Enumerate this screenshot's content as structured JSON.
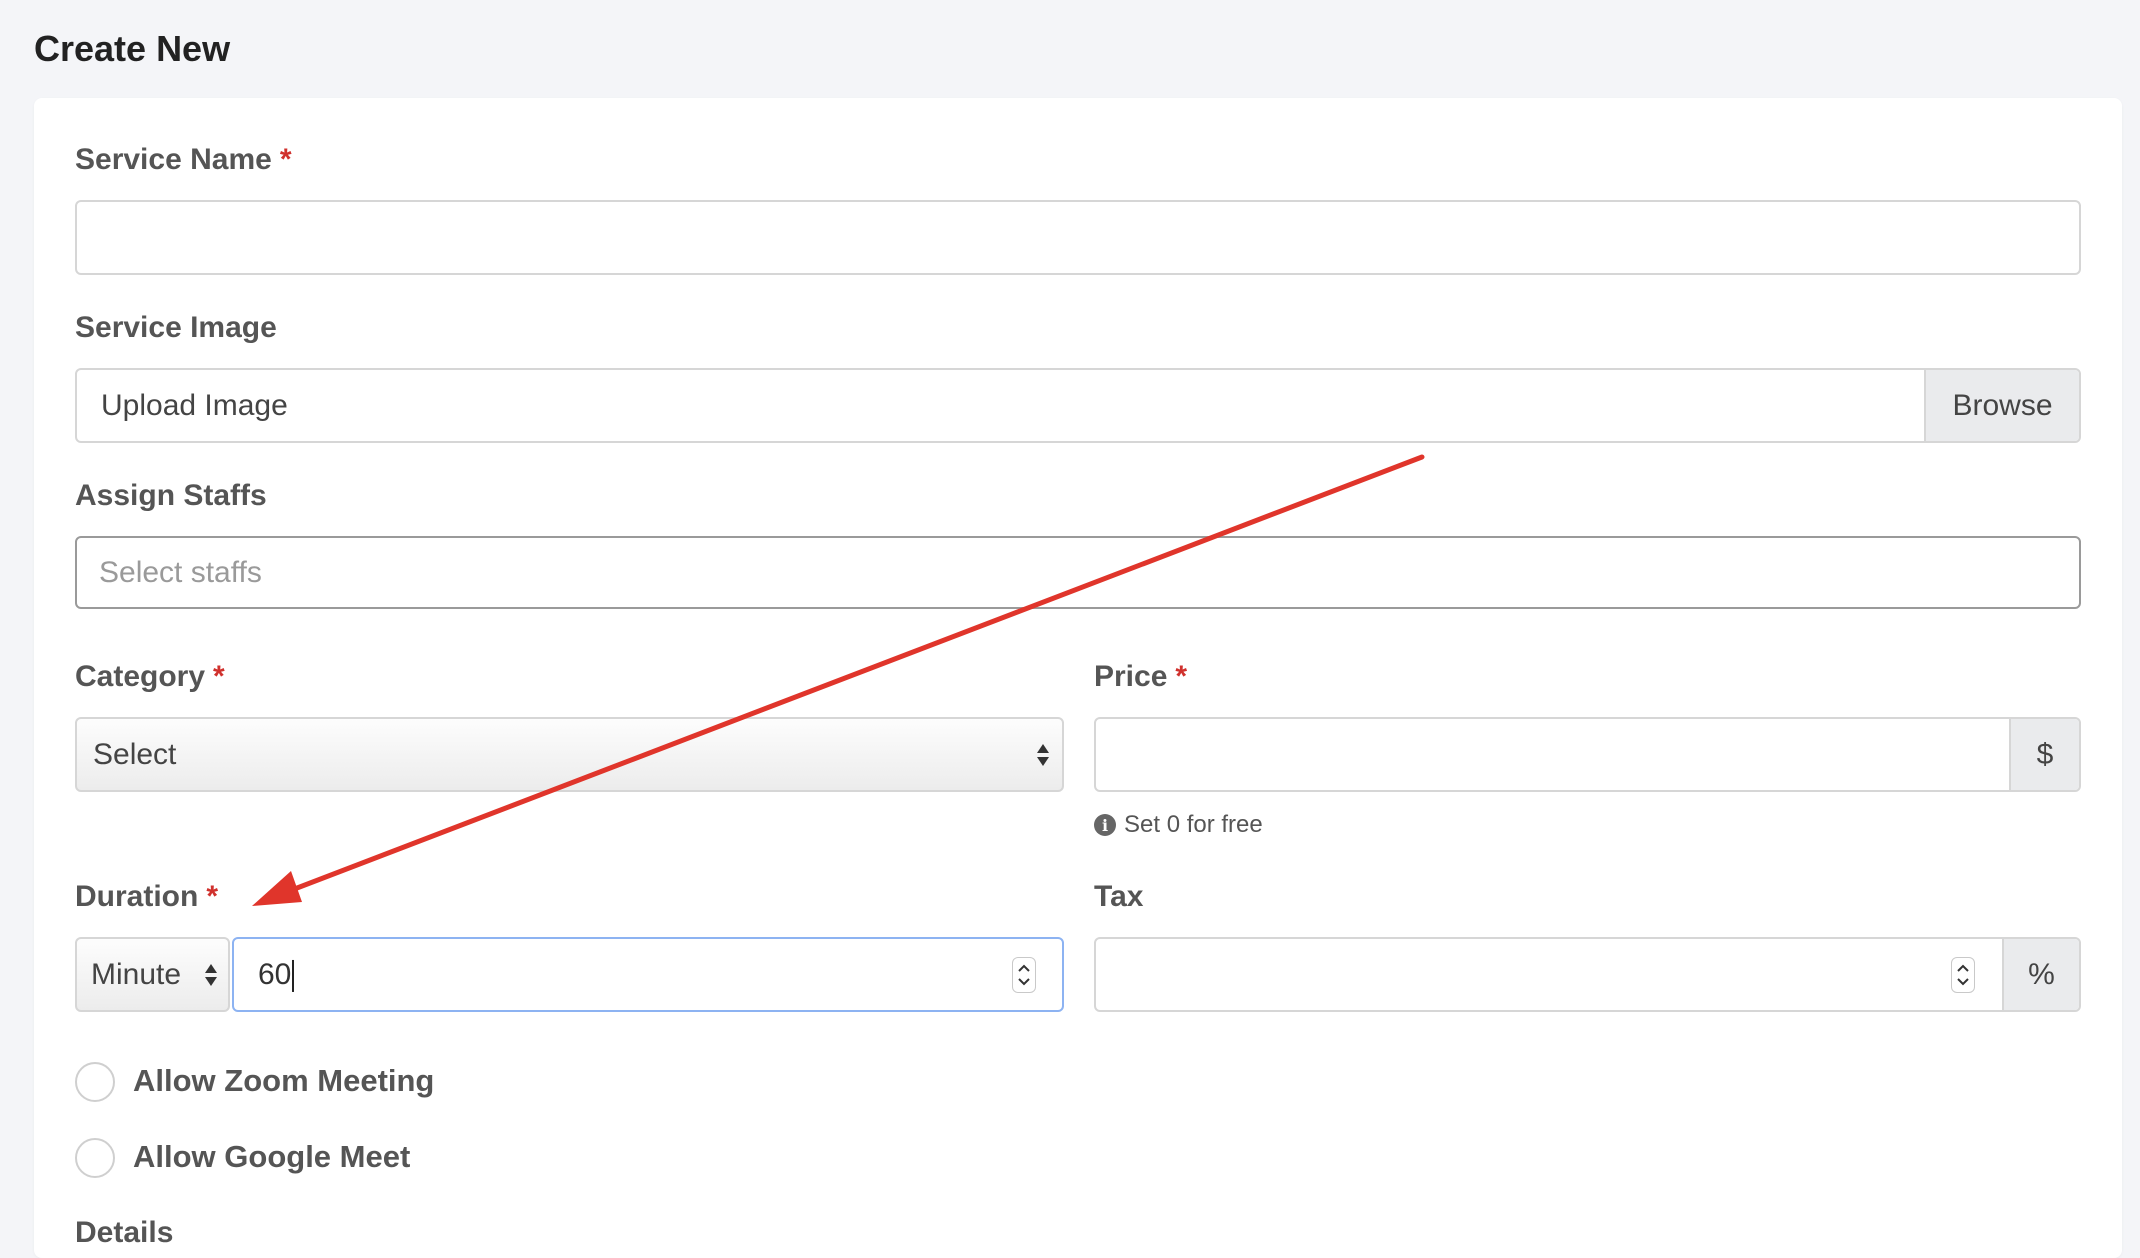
{
  "page": {
    "title": "Create New"
  },
  "form": {
    "service_name": {
      "label": "Service Name",
      "required_mark": "*",
      "value": ""
    },
    "service_image": {
      "label": "Service Image",
      "text": "Upload Image",
      "browse_label": "Browse"
    },
    "assign_staffs": {
      "label": "Assign Staffs",
      "placeholder": "Select staffs"
    },
    "category": {
      "label": "Category",
      "required_mark": "*",
      "selected": "Select"
    },
    "price": {
      "label": "Price",
      "required_mark": "*",
      "value": "",
      "currency": "$",
      "help": "Set 0 for free",
      "help_icon": "i"
    },
    "duration": {
      "label": "Duration",
      "required_mark": "*",
      "unit": "Minute",
      "value": "60"
    },
    "tax": {
      "label": "Tax",
      "value": "",
      "suffix": "%"
    },
    "allow_zoom": {
      "label": "Allow Zoom Meeting",
      "checked": false
    },
    "allow_google_meet": {
      "label": "Allow Google Meet",
      "checked": false
    },
    "details": {
      "label": "Details"
    }
  },
  "annotation": {
    "arrow_color": "#e0352b"
  },
  "colors": {
    "focus_border": "#8db3f2",
    "required": "#d0312d"
  }
}
